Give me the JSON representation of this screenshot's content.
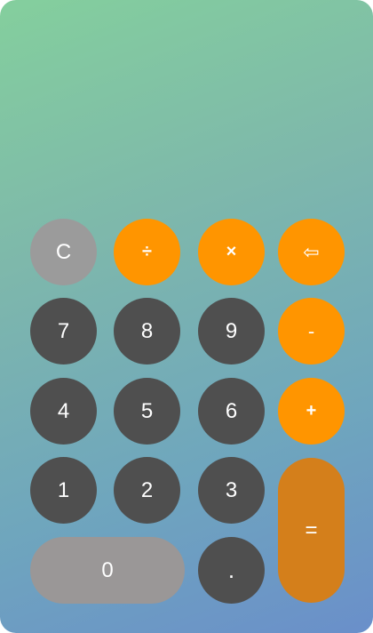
{
  "display": {
    "value": ""
  },
  "keys": {
    "clear": "C",
    "divide": "÷",
    "multiply": "×",
    "backspace": "⇦",
    "seven": "7",
    "eight": "8",
    "nine": "9",
    "minus": "-",
    "four": "4",
    "five": "5",
    "six": "6",
    "plus": "+",
    "one": "1",
    "two": "2",
    "three": "3",
    "equals": "=",
    "zero": "0",
    "decimal": "."
  },
  "colors": {
    "digit_key": "#4f4f4f",
    "clear_key": "#9b9b9b",
    "operator_key": "#ff9500",
    "equals_key": "#d47f1b",
    "zero_key": "#9a9797",
    "gradient_start": "#84cf9d",
    "gradient_end": "#6a8fca"
  }
}
